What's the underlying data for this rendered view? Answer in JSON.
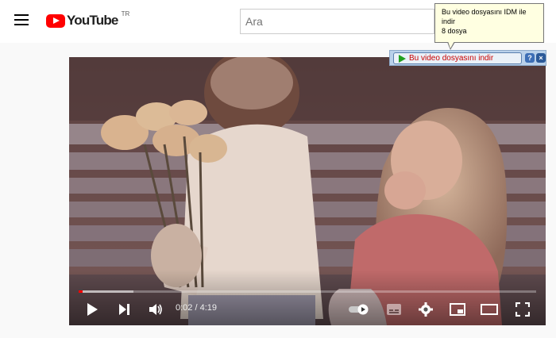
{
  "header": {
    "logo_text": "YouTube",
    "logo_region": "TR",
    "search_placeholder": "Ara"
  },
  "idm": {
    "tooltip_line1": "Bu video dosyasını IDM ile indir",
    "tooltip_line2": "8  dosya",
    "button_label": "Bu video dosyasını indir",
    "help_label": "?",
    "close_label": "×"
  },
  "player": {
    "time_display": "0:02 / 4:19",
    "progress_played_fraction": 0.008,
    "progress_loaded_fraction": 0.12,
    "autoplay_on": true
  },
  "colors": {
    "brand_red": "#ff0000",
    "idm_label": "#c80000"
  },
  "icons": [
    "menu-icon",
    "play-icon",
    "next-icon",
    "volume-icon",
    "autoplay-toggle-icon",
    "subtitles-icon",
    "settings-icon",
    "miniplayer-icon",
    "theater-mode-icon",
    "fullscreen-icon",
    "idm-download-arrow-icon"
  ]
}
